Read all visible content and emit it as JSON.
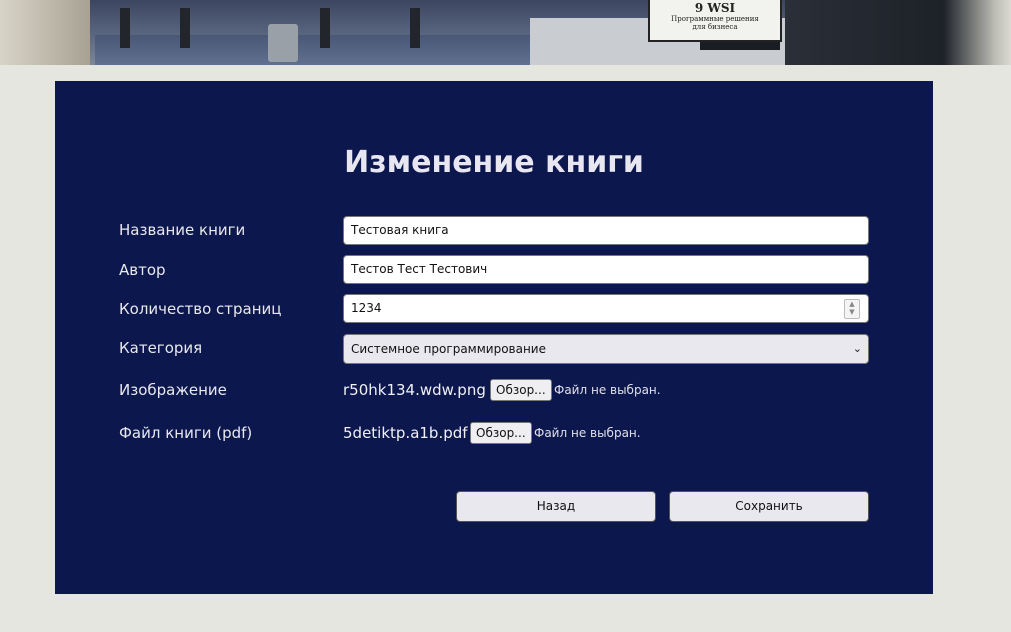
{
  "header_image": {
    "sign_line1": "9 WSI",
    "sign_line2": "Программные решения",
    "sign_line3": "для бизнеса"
  },
  "form": {
    "title": "Изменение книги",
    "fields": {
      "name": {
        "label": "Название книги",
        "value": "Тестовая книга"
      },
      "author": {
        "label": "Автор",
        "value": "Тестов Тест Тестович"
      },
      "pages": {
        "label": "Количество страниц",
        "value": "1234"
      },
      "category": {
        "label": "Категория",
        "selected": "Системное программирование"
      },
      "image": {
        "label": "Изображение",
        "current_file": "r50hk134.wdw.png",
        "browse_label": "Обзор...",
        "status": "Файл не выбран."
      },
      "pdf": {
        "label": "Файл книги (pdf)",
        "current_file": "5detiktp.a1b.pdf",
        "browse_label": "Обзор...",
        "status": "Файл не выбран."
      }
    },
    "buttons": {
      "back": "Назад",
      "save": "Сохранить"
    }
  },
  "colors": {
    "page_background": "#e6e6e0",
    "card_background": "#0c174d",
    "text_light": "#e8e8ee"
  }
}
